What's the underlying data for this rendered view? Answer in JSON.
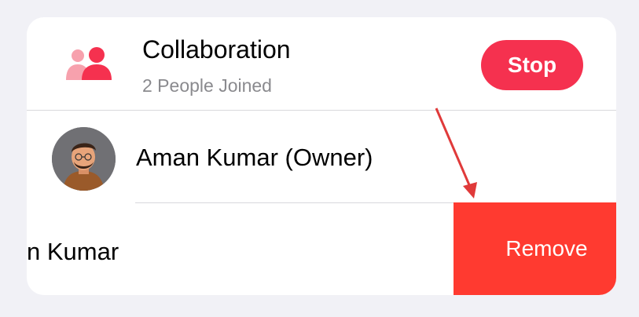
{
  "collaboration": {
    "title": "Collaboration",
    "subtitle": "2 People Joined",
    "stop_label": "Stop",
    "accent_color": "#f5314f"
  },
  "participants": [
    {
      "name": "Aman Kumar (Owner)"
    },
    {
      "name": "n Kumar",
      "swipe_action_label": "Remove",
      "swipe_action_color": "#ff3a30"
    }
  ],
  "annotation": {
    "color": "#e03a3a",
    "icon": "red-arrow-icon"
  }
}
